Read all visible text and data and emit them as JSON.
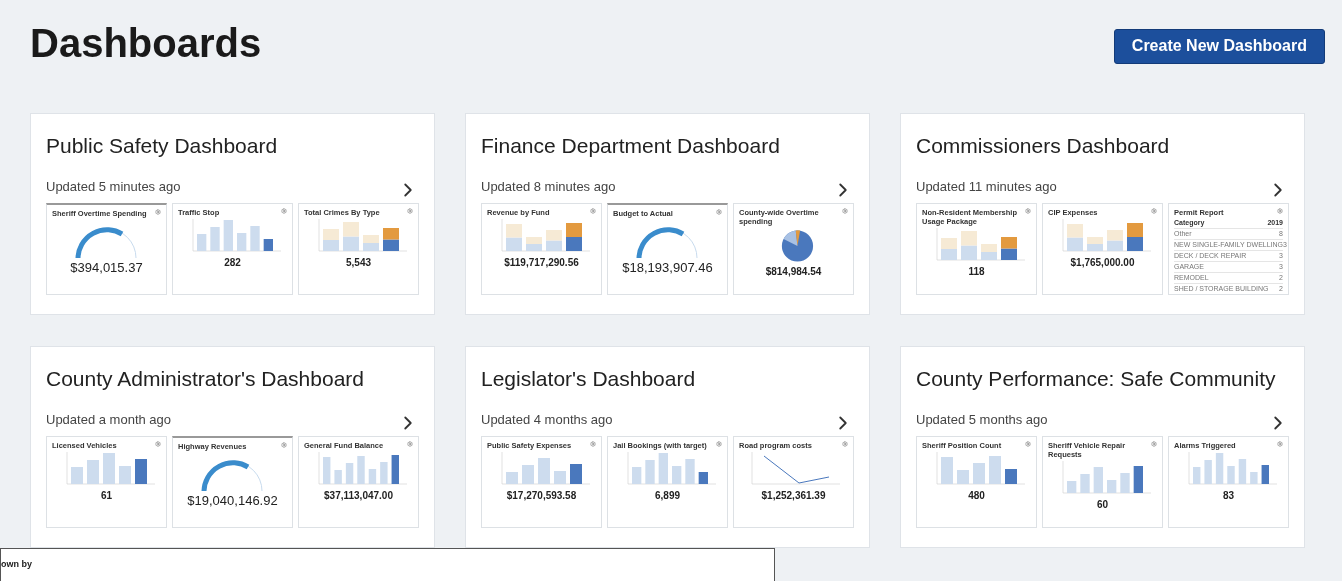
{
  "title": "Dashboards",
  "create_button": "Create New Dashboard",
  "dashboards": [
    {
      "name": "Public Safety Dashboard",
      "updated": "Updated 5 minutes ago",
      "widgets": [
        {
          "kind": "gauge",
          "title": "Sheriff Overtime Spending",
          "value": "$394,015.37"
        },
        {
          "kind": "bar",
          "title": "Traffic Stop",
          "value": "282"
        },
        {
          "kind": "stacked",
          "title": "Total Crimes By Type",
          "value": "5,543"
        }
      ]
    },
    {
      "name": "Finance Department Dashboard",
      "updated": "Updated 8 minutes ago",
      "widgets": [
        {
          "kind": "stacked",
          "title": "Revenue by Fund",
          "value": "$119,717,290.56"
        },
        {
          "kind": "gauge",
          "title": "Budget to Actual",
          "value": "$18,193,907.46"
        },
        {
          "kind": "pie",
          "title": "County-wide Overtime spending",
          "value": "$814,984.54"
        }
      ]
    },
    {
      "name": "Commissioners Dashboard",
      "updated": "Updated 11 minutes ago",
      "widgets": [
        {
          "kind": "stacked",
          "title": "Non-Resident Membership Usage Package",
          "value": "118"
        },
        {
          "kind": "stacked",
          "title": "CIP Expenses",
          "value": "$1,765,000.00"
        },
        {
          "kind": "table",
          "title": "Permit Report",
          "header": [
            "Category",
            "2019"
          ],
          "rows": [
            [
              "Other",
              "8"
            ],
            [
              "NEW SINGLE-FAMILY DWELLING",
              "3"
            ],
            [
              "DECK / DECK REPAIR",
              "3"
            ],
            [
              "GARAGE",
              "3"
            ],
            [
              "REMODEL",
              "2"
            ],
            [
              "SHED / STORAGE BUILDING",
              "2"
            ]
          ]
        }
      ]
    },
    {
      "name": "County Administrator's Dashboard",
      "updated": "Updated a month ago",
      "widgets": [
        {
          "kind": "bar",
          "title": "Licensed Vehicles",
          "value": "61"
        },
        {
          "kind": "gauge",
          "title": "Highway Revenues",
          "value": "$19,040,146.92"
        },
        {
          "kind": "bar",
          "title": "General Fund Balance",
          "value": "$37,113,047.00"
        }
      ]
    },
    {
      "name": "Legislator's Dashboard",
      "updated": "Updated 4 months ago",
      "widgets": [
        {
          "kind": "bar",
          "title": "Public Safety Expenses",
          "value": "$17,270,593.58"
        },
        {
          "kind": "bar",
          "title": "Jail Bookings (with target)",
          "value": "6,899"
        },
        {
          "kind": "line",
          "title": "Road program costs",
          "value": "$1,252,361.39"
        }
      ]
    },
    {
      "name": "County Performance: Safe Community",
      "updated": "Updated 5 months ago",
      "widgets": [
        {
          "kind": "bar",
          "title": "Sheriff Position Count",
          "value": "480"
        },
        {
          "kind": "bar",
          "title": "Sheriff Vehicle Repair Requests",
          "value": "60"
        },
        {
          "kind": "bar",
          "title": "Alarms Triggered",
          "value": "83"
        }
      ]
    }
  ],
  "overlay": {
    "label": "own by"
  }
}
